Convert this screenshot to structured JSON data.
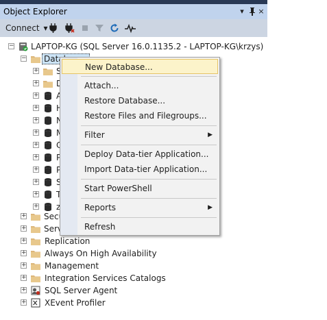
{
  "panel": {
    "title": "Object Explorer",
    "pin_glyph": "⊣",
    "dropdown_glyph": "▾",
    "close_glyph": "×"
  },
  "toolbar": {
    "connect_label": "Connect",
    "connect_dropdown": "▾"
  },
  "tree": {
    "server_label": "LAPTOP-KG (SQL Server 16.0.1135.2 - LAPTOP-KG\\krzys)",
    "databases_label": "Databases",
    "hidden_db_initials": [
      "S",
      "D",
      "A",
      "H",
      "N",
      "M",
      "N",
      "C",
      "P",
      "P",
      "S",
      "T",
      "z"
    ],
    "top_folders": [
      "Secu",
      "Serv"
    ],
    "folders": [
      "Replication",
      "Always On High Availability",
      "Management",
      "Integration Services Catalogs"
    ],
    "agent_label": "SQL Server Agent",
    "xevent_label": "XEvent Profiler",
    "expander_plus": "+",
    "expander_minus": "−"
  },
  "context_menu": {
    "items": [
      {
        "label": "New Database...",
        "highlighted": true
      },
      {
        "label": "Attach..."
      },
      {
        "label": "Restore Database..."
      },
      {
        "label": "Restore Files and Filegroups..."
      },
      {
        "label": "Filter",
        "submenu": true
      },
      {
        "label": "Deploy Data-tier Application..."
      },
      {
        "label": "Import Data-tier Application..."
      },
      {
        "label": "Start PowerShell"
      },
      {
        "label": "Reports",
        "submenu": true
      },
      {
        "label": "Refresh"
      }
    ],
    "submenu_arrow": "▶"
  },
  "colors": {
    "title_bg": "#c0d3ed",
    "toolbar_bg": "#ccd5e2",
    "menu_highlight": "#fcf3ca",
    "folder": "#dcb67a",
    "db_cylinder": "#2b2b2b"
  }
}
